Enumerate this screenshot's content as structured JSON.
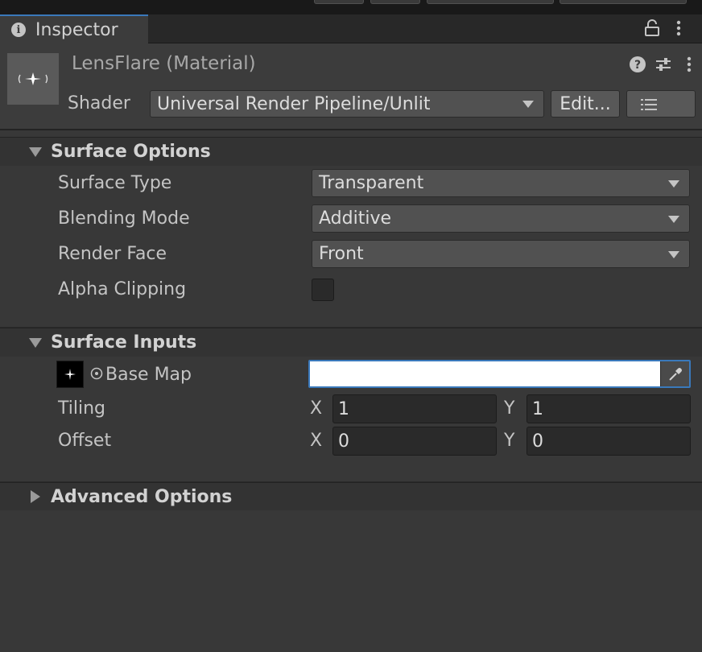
{
  "window": {
    "tab_label": "Inspector"
  },
  "header": {
    "material_title": "LensFlare (Material)",
    "shader_label": "Shader",
    "shader_value": "Universal Render Pipeline/Unlit",
    "edit_button": "Edit..."
  },
  "surface_options": {
    "title": "Surface Options",
    "props": [
      {
        "label": "Surface Type",
        "value": "Transparent"
      },
      {
        "label": "Blending Mode",
        "value": "Additive"
      },
      {
        "label": "Render Face",
        "value": "Front"
      },
      {
        "label": "Alpha Clipping",
        "checked": false
      }
    ]
  },
  "surface_inputs": {
    "title": "Surface Inputs",
    "base_map_label": "Base Map",
    "tiling": {
      "label": "Tiling",
      "x_label": "X",
      "x": "1",
      "y_label": "Y",
      "y": "1"
    },
    "offset": {
      "label": "Offset",
      "x_label": "X",
      "x": "0",
      "y_label": "Y",
      "y": "0"
    }
  },
  "advanced_options": {
    "title": "Advanced Options",
    "expanded": false
  },
  "colors": {
    "accent": "#3a79bb",
    "panel": "#383838",
    "header": "#3c3c3c"
  }
}
